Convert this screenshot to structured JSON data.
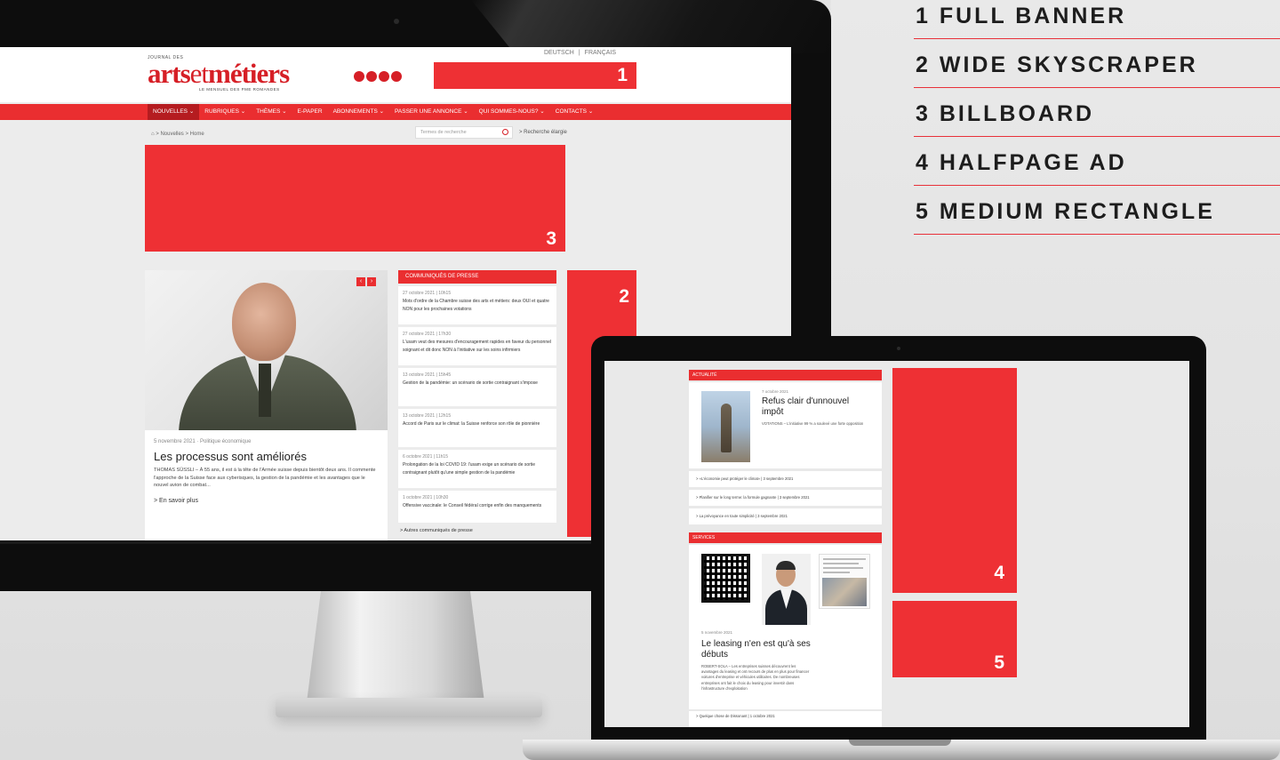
{
  "legend": [
    {
      "label": "1 FULL BANNER"
    },
    {
      "label": "2 WIDE SKYSCRAPER"
    },
    {
      "label": "3 BILLBOARD"
    },
    {
      "label": "4 HALFPAGE AD"
    },
    {
      "label": "5 MEDIUM RECTANGLE"
    }
  ],
  "ad_numbers": {
    "full_banner": "1",
    "wide_skyscraper": "2",
    "billboard": "3",
    "halfpage": "4",
    "medium_rectangle": "5"
  },
  "site": {
    "logo_small": "JOURNAL DES",
    "logo_part1": "arts",
    "logo_part2": "et",
    "logo_part3": "métiers",
    "logo_sub": "LE MENSUEL DES PME ROMANDES",
    "lang_de": "DEUTSCH",
    "lang_sep": "|",
    "lang_fr": "FRANÇAIS",
    "nav": [
      "NOUVELLES ⌄",
      "RUBRIQUES ⌄",
      "THÈMES ⌄",
      "E-PAPER",
      "ABONNEMENTS ⌄",
      "PASSER UNE ANNONCE ⌄",
      "QUI SOMMES-NOUS? ⌄",
      "CONTACTS ⌄"
    ],
    "breadcrumb": "⌂ > Nouvelles > Home",
    "search_placeholder": "Termes de recherche",
    "advanced_search": "> Recherche élargie",
    "slider_prev": "‹",
    "slider_next": "›",
    "feature": {
      "meta": "5 novembre 2021 · Politique économique",
      "title": "Les processus sont améliorés",
      "text": "THOMAS SÜSSLI – À 55 ans, il est à la tête de l'Armée suisse depuis bientôt deux ans. Il commente l'approche de la Suisse face aux cyberisques, la gestion de la pandémie et les avantages que le nouvel avion de combat...",
      "more": "> En savoir plus"
    },
    "press_heading": "COMMUNIQUÉS DE PRESSE",
    "press": [
      {
        "date": "27 octobre 2021 | 10h15",
        "text": "Mots d'ordre de la Chambre suisse des arts et métiers: deux OUI et quatre NON pour les prochaines votations"
      },
      {
        "date": "27 octobre 2021 | 17h30",
        "text": "L'usam veut des mesures d'encouragement rapides en faveur du personnel soignant et dit donc NON à l'initiative sur les soins infirmiers"
      },
      {
        "date": "13 octobre 2021 | 15h45",
        "text": "Gestion de la pandémie: un scénario de sortie contraignant s'impose"
      },
      {
        "date": "13 octobre 2021 | 12h15",
        "text": "Accord de Paris sur le climat: la Suisse renforce son rôle de pionnière"
      },
      {
        "date": "6 octobre 2021 | 11h15",
        "text": "Prolongation de la loi COVID 19: l'usam exige un scénario de sortie contraignant plutôt qu'une simple gestion de la pandémie"
      },
      {
        "date": "1 octobre 2021 | 10h30",
        "text": "Offensive vaccinale: le Conseil fédéral corrige enfin des manquements"
      }
    ],
    "press_more": "> Autres communiqués de presse"
  },
  "laptop": {
    "actu_heading": "ACTUALITÉ",
    "actu_date": "7 octobre 2021",
    "actu_title": "Refus clair d'unnouvel impôt",
    "actu_text": "VOTATIONS – L'initiative 99 % a soulevé une forte opposition",
    "actu_links": [
      "> «L'économie peut protéger le climat» | 3 septembre 2021",
      "> Planifier sur le long terme: la formule gagnante | 3 septembre 2021",
      "> La prévoyance en toute simplicité | 3 septembre 2021"
    ],
    "serv_heading": "SERVICES",
    "serv_date": "5 novembre 2021",
    "serv_title": "Le leasing n'en est qu'à ses débuts",
    "serv_text": "ROBERT-SOLA – Les entreprises suisses découvrent les avantages du leasing et ont recours de plus en plus pour financer voitures d'entreprise et véhicules utilitaires. De nombreuses entreprises ont fait le choix du leasing pour investir dans l'infrastructure d'exploitation",
    "serv_link": "> Quelque chose de Dissonant | 1 octobre 2021"
  }
}
